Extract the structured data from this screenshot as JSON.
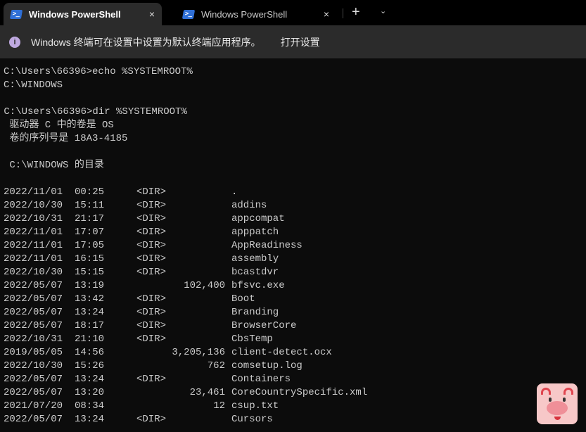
{
  "tabs": [
    {
      "title": "Windows PowerShell",
      "active": true
    },
    {
      "title": "Windows PowerShell",
      "active": false
    }
  ],
  "tab_icons": {
    "close": "×",
    "new": "+",
    "dropdown": "⌄"
  },
  "infobar": {
    "message": "Windows 终端可在设置中设置为默认终端应用程序。",
    "link": "打开设置"
  },
  "terminal": {
    "header_lines": [
      "C:\\Users\\66396>echo %SYSTEMROOT%",
      "C:\\WINDOWS",
      "",
      " C:\\Users\\66396>dir %SYSTEMROOT%",
      " 驱动器 C 中的卷是 OS",
      " 卷的序列号是 18A3-4185",
      "",
      " C:\\WINDOWS 的目录",
      ""
    ],
    "entries": [
      {
        "date": "2022/11/01",
        "time": "00:25",
        "dir": "<DIR>",
        "size": "",
        "name": "."
      },
      {
        "date": "2022/10/30",
        "time": "15:11",
        "dir": "<DIR>",
        "size": "",
        "name": "addins"
      },
      {
        "date": "2022/10/31",
        "time": "21:17",
        "dir": "<DIR>",
        "size": "",
        "name": "appcompat"
      },
      {
        "date": "2022/11/01",
        "time": "17:07",
        "dir": "<DIR>",
        "size": "",
        "name": "apppatch"
      },
      {
        "date": "2022/11/01",
        "time": "17:05",
        "dir": "<DIR>",
        "size": "",
        "name": "AppReadiness"
      },
      {
        "date": "2022/11/01",
        "time": "16:15",
        "dir": "<DIR>",
        "size": "",
        "name": "assembly"
      },
      {
        "date": "2022/10/30",
        "time": "15:15",
        "dir": "<DIR>",
        "size": "",
        "name": "bcastdvr"
      },
      {
        "date": "2022/05/07",
        "time": "13:19",
        "dir": "",
        "size": "102,400",
        "name": "bfsvc.exe"
      },
      {
        "date": "2022/05/07",
        "time": "13:42",
        "dir": "<DIR>",
        "size": "",
        "name": "Boot"
      },
      {
        "date": "2022/05/07",
        "time": "13:24",
        "dir": "<DIR>",
        "size": "",
        "name": "Branding"
      },
      {
        "date": "2022/05/07",
        "time": "18:17",
        "dir": "<DIR>",
        "size": "",
        "name": "BrowserCore"
      },
      {
        "date": "2022/10/31",
        "time": "21:10",
        "dir": "<DIR>",
        "size": "",
        "name": "CbsTemp"
      },
      {
        "date": "2019/05/05",
        "time": "14:56",
        "dir": "",
        "size": "3,205,136",
        "name": "client-detect.ocx"
      },
      {
        "date": "2022/10/30",
        "time": "15:26",
        "dir": "",
        "size": "762",
        "name": "comsetup.log"
      },
      {
        "date": "2022/05/07",
        "time": "13:24",
        "dir": "<DIR>",
        "size": "",
        "name": "Containers"
      },
      {
        "date": "2022/05/07",
        "time": "13:20",
        "dir": "",
        "size": "23,461",
        "name": "CoreCountrySpecific.xml"
      },
      {
        "date": "2021/07/20",
        "time": "08:34",
        "dir": "",
        "size": "12",
        "name": "csup.txt"
      },
      {
        "date": "2022/05/07",
        "time": "13:24",
        "dir": "<DIR>",
        "size": "",
        "name": "Cursors"
      }
    ]
  }
}
